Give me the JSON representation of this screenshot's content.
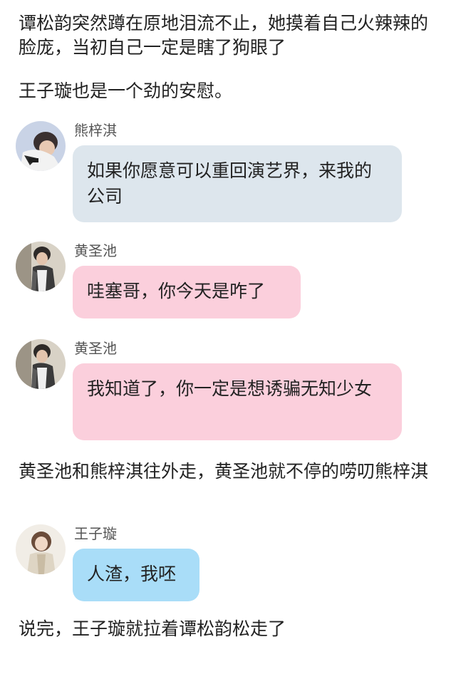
{
  "colors": {
    "bubble_xiong": "#dde6ed",
    "bubble_huang": "#fbcfdc",
    "bubble_wang": "#a9ddf8",
    "text": "#222222",
    "sender_name": "#555555"
  },
  "narration": {
    "p1": "谭松韵突然蹲在原地泪流不止，她摸着自己火辣辣的脸庞，当初自己一定是瞎了狗眼了",
    "p2": "王子璇也是一个劲的安慰。",
    "p3": "黄圣池和熊梓淇往外走，黄圣池就不停的唠叨熊梓淇",
    "p4": "说完，王子璇就拉着谭松韵松走了"
  },
  "messages": [
    {
      "sender": "熊梓淇",
      "text": "如果你愿意可以重回演艺界，来我的公司",
      "avatar_icon": "avatar-xiong-icon"
    },
    {
      "sender": "黄圣池",
      "text": "哇塞哥，你今天是咋了",
      "avatar_icon": "avatar-huang-icon"
    },
    {
      "sender": "黄圣池",
      "text": "我知道了，你一定是想诱骗无知少女",
      "avatar_icon": "avatar-huang-icon"
    },
    {
      "sender": "王子璇",
      "text": "人渣，我呸",
      "avatar_icon": "avatar-wang-icon"
    }
  ]
}
